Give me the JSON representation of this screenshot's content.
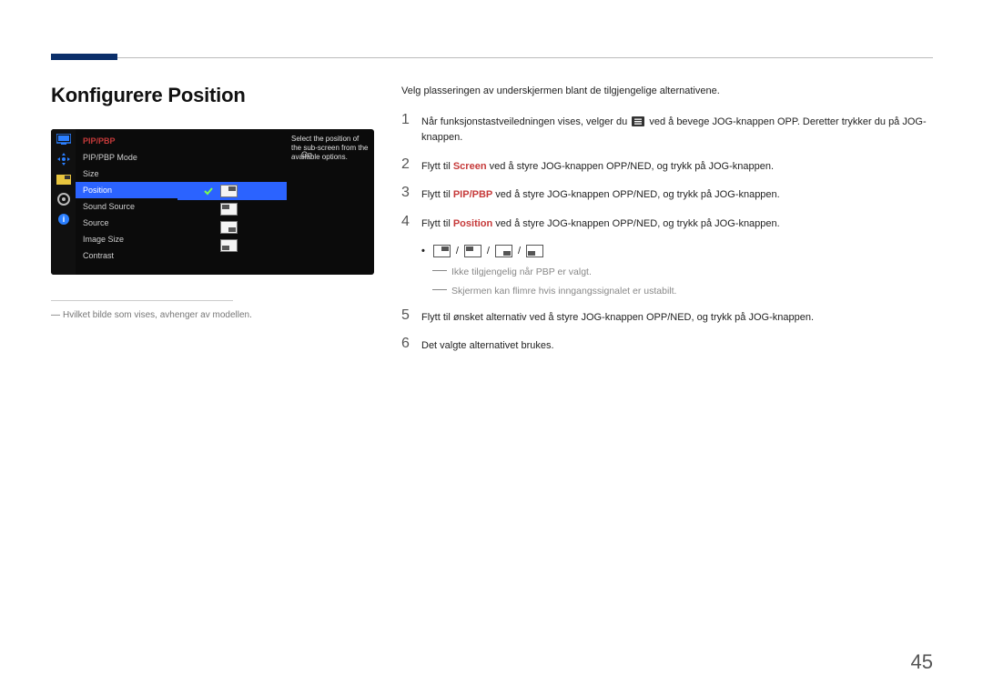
{
  "page_number": "45",
  "title": "Konfigurere Position",
  "osd": {
    "header": "PIP/PBP",
    "tooltip": "Select the position of the sub-screen from the available options.",
    "rows": {
      "mode": "PIP/PBP Mode",
      "mode_value": "On",
      "size": "Size",
      "position": "Position",
      "sound": "Sound Source",
      "source": "Source",
      "img": "Image Size",
      "contrast": "Contrast"
    }
  },
  "footnote": "Hvilket bilde som vises, avhenger av modellen.",
  "intro": "Velg plasseringen av underskjermen blant de tilgjengelige alternativene.",
  "steps": {
    "s1a": "Når funksjonstastveiledningen vises, velger du ",
    "s1b": " ved å bevege JOG-knappen OPP. Deretter trykker du på JOG-knappen.",
    "s2a": "Flytt til ",
    "s2_screen": "Screen",
    "s2b": " ved å styre JOG-knappen OPP/NED, og trykk på JOG-knappen.",
    "s3_pip": "PIP/PBP",
    "s3b": " ved å styre JOG-knappen OPP/NED, og trykk på JOG-knappen.",
    "s4_pos": "Position",
    "s4b": " ved å styre JOG-knappen OPP/NED, og trykk på JOG-knappen.",
    "note1": "Ikke tilgjengelig når PBP er valgt.",
    "note2": "Skjermen kan flimre hvis inngangssignalet er ustabilt.",
    "s5": "Flytt til ønsket alternativ ved å styre JOG-knappen OPP/NED, og trykk på JOG-knappen.",
    "s6": "Det valgte alternativet brukes."
  }
}
